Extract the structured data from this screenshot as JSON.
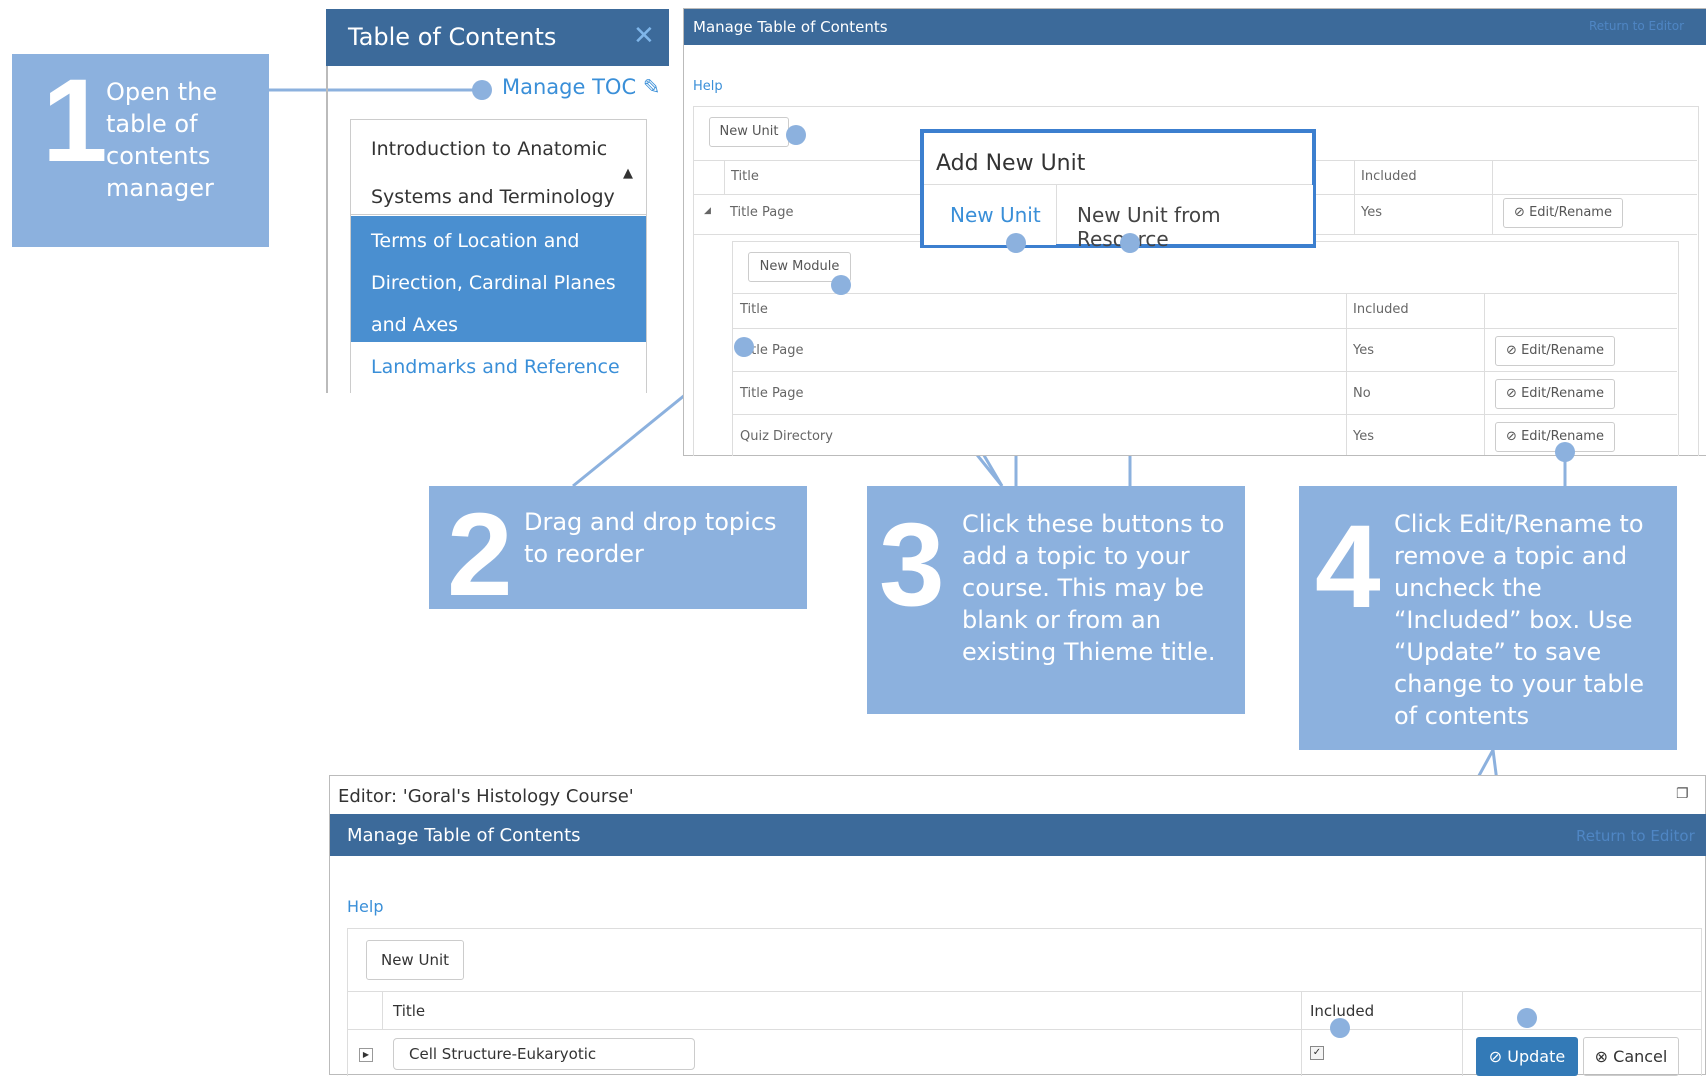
{
  "callouts": [
    {
      "number": "1",
      "text": "Open the table of contents manager"
    },
    {
      "number": "2",
      "text": "Drag and drop topics to reorder"
    },
    {
      "number": "3",
      "text": "Click these buttons to add a topic to your course. This may be blank or from an existing Thieme title."
    },
    {
      "number": "4",
      "text": "Click Edit/Rename to remove a topic and uncheck the “Included” box. Use “Update” to save change to your table of contents"
    }
  ],
  "toc": {
    "title": "Table of Contents",
    "close_icon": "close-icon",
    "manage_link": "Manage TOC",
    "manage_icon": "pencil-icon",
    "items": [
      {
        "line1": "Introduction to Anatomic",
        "line2": "Systems and Terminology"
      },
      {
        "line1": "Terms of Location and",
        "line2": "Direction, Cardinal Planes",
        "line3": "and Axes"
      },
      {
        "line1": "Landmarks and Reference"
      }
    ]
  },
  "manager_top": {
    "title": "Manage Table of Contents",
    "return_link": "Return to Editor",
    "help": "Help",
    "new_unit": "New Unit",
    "col_title": "Title",
    "col_included": "Included",
    "unit_row": {
      "title": "Title Page",
      "included": "Yes",
      "action": "Edit/Rename"
    },
    "new_module": "New Module",
    "module_rows": [
      {
        "title": "Title Page",
        "included": "Yes",
        "action": "Edit/Rename"
      },
      {
        "title": "Title Page",
        "included": "No",
        "action": "Edit/Rename"
      },
      {
        "title": "Quiz Directory",
        "included": "Yes",
        "action": "Edit/Rename"
      }
    ]
  },
  "add_new_unit": {
    "title": "Add New Unit",
    "tab_new": "New Unit",
    "tab_resource": "New Unit from Resource"
  },
  "editor": {
    "window_title": "Editor: 'Goral's Histology Course'",
    "header": "Manage Table of Contents",
    "return_link": "Return to Editor",
    "help": "Help",
    "new_unit": "New Unit",
    "col_title": "Title",
    "col_included": "Included",
    "row_value": "Cell Structure-Eukaryotic",
    "update": "Update",
    "cancel": "Cancel"
  },
  "colors": {
    "callout": "#8cb1de",
    "header": "#3c6a9a",
    "link": "#3a8fd8",
    "selected": "#4a8fd0",
    "update": "#337ab7"
  }
}
